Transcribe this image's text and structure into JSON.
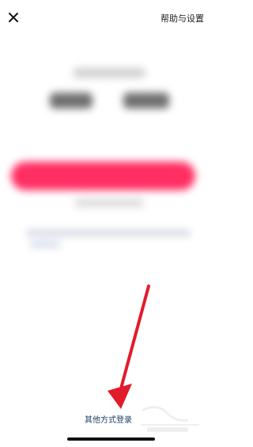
{
  "header": {
    "close_icon": "close-icon",
    "help_label": "帮助与设置"
  },
  "footer": {
    "other_login_label": "其他方式登录"
  },
  "annotation": {
    "arrow_icon": "red-arrow-icon",
    "arrow_color": "#e21b2b"
  },
  "blurred_content": {
    "brand_color": "#ff2e63"
  }
}
